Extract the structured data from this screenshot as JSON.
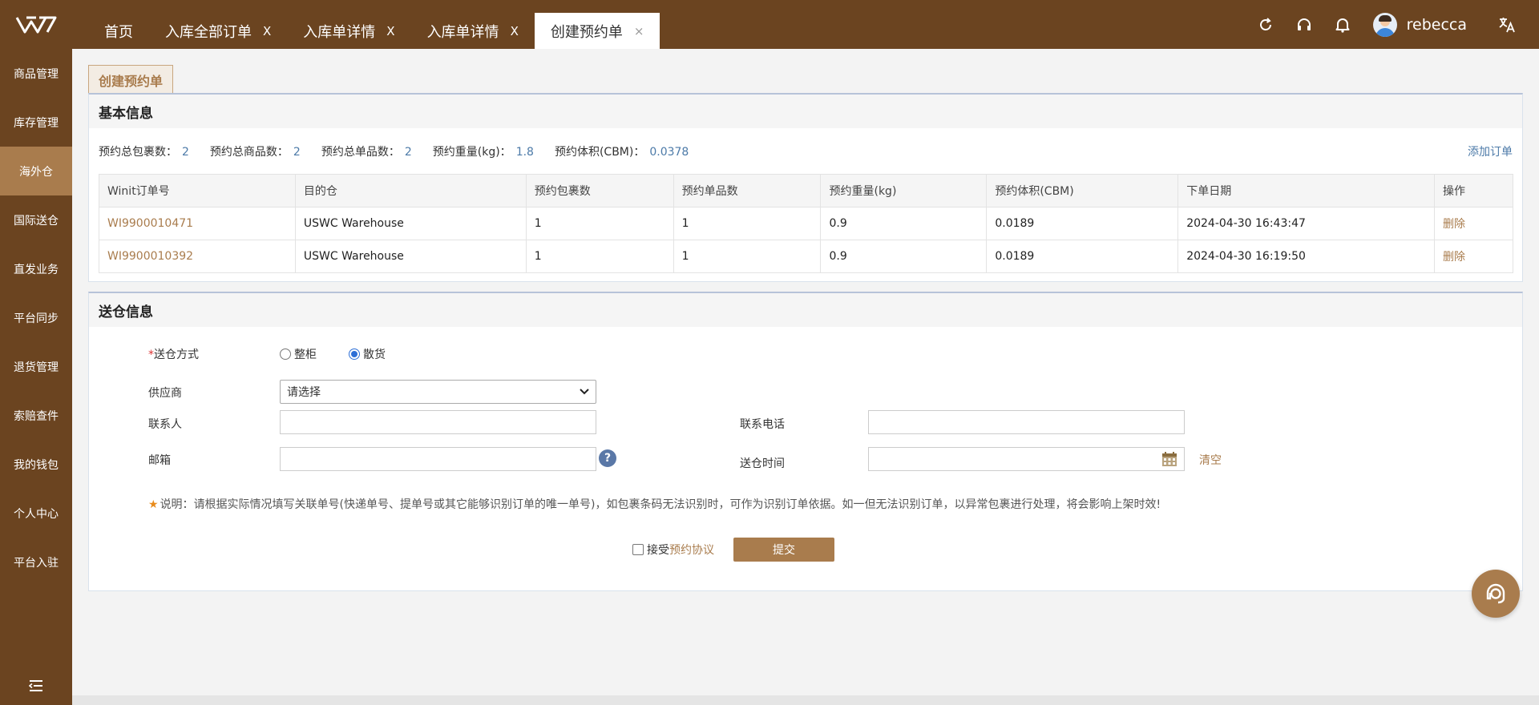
{
  "tabs": [
    {
      "label": "首页",
      "closable": false
    },
    {
      "label": "入库全部订单",
      "closable": true
    },
    {
      "label": "入库单详情",
      "closable": true
    },
    {
      "label": "入库单详情",
      "closable": true
    },
    {
      "label": "创建预约单",
      "closable": true,
      "active": true
    }
  ],
  "tab_close_symbol": "X",
  "user": {
    "name": "rebecca"
  },
  "top_icons": [
    "refresh-icon",
    "headset-icon",
    "bell-icon",
    "translate-icon"
  ],
  "sidebar": {
    "items": [
      {
        "label": "商品管理"
      },
      {
        "label": "库存管理"
      },
      {
        "label": "海外仓",
        "active": true
      },
      {
        "label": "国际送仓"
      },
      {
        "label": "直发业务"
      },
      {
        "label": "平台同步"
      },
      {
        "label": "退货管理"
      },
      {
        "label": "索赔查件"
      },
      {
        "label": "我的钱包"
      },
      {
        "label": "个人中心"
      },
      {
        "label": "平台入驻"
      }
    ]
  },
  "page_tab": "创建预约单",
  "basic": {
    "title": "基本信息",
    "summary": [
      {
        "label": "预约总包裹数：",
        "value": "2"
      },
      {
        "label": "预约总商品数：",
        "value": "2"
      },
      {
        "label": "预约总单品数：",
        "value": "2"
      },
      {
        "label": "预约重量(kg)：",
        "value": "1.8"
      },
      {
        "label": "预约体积(CBM)：",
        "value": "0.0378"
      }
    ],
    "add_order": "添加订单",
    "columns": [
      "Winit订单号",
      "目的仓",
      "预约包裹数",
      "预约单品数",
      "预约重量(kg)",
      "预约体积(CBM)",
      "下单日期",
      "操作"
    ],
    "rows": [
      {
        "order": "WI9900010471",
        "warehouse": "USWC Warehouse",
        "packages": "1",
        "items": "1",
        "weight": "0.9",
        "volume": "0.0189",
        "date": "2024-04-30 16:43:47",
        "action": "删除"
      },
      {
        "order": "WI9900010392",
        "warehouse": "USWC Warehouse",
        "packages": "1",
        "items": "1",
        "weight": "0.9",
        "volume": "0.0189",
        "date": "2024-04-30 16:19:50",
        "action": "删除"
      }
    ]
  },
  "delivery": {
    "title": "送仓信息",
    "method_label": "送仓方式",
    "method_required": "*",
    "options": [
      {
        "label": "整柜",
        "checked": false
      },
      {
        "label": "散货",
        "checked": true
      }
    ],
    "supplier_label": "供应商",
    "supplier_value": "请选择",
    "contact_label": "联系人",
    "phone_label": "联系电话",
    "email_label": "邮箱",
    "time_label": "送仓时间",
    "clear": "清空",
    "note_prefix": "说明：",
    "note": "请根据实际情况填写关联单号(快递单号、提单号或其它能够识别订单的唯一单号)，如包裹条码无法识别时，可作为识别订单依据。如一但无法识别订单，以异常包裹进行处理，将会影响上架时效!",
    "agree_prefix": "接受",
    "agree_link": "预约协议",
    "submit": "提交"
  },
  "colors": {
    "brand": "#6b4420",
    "accent": "#a97c4d",
    "link": "#4c7aa8"
  }
}
